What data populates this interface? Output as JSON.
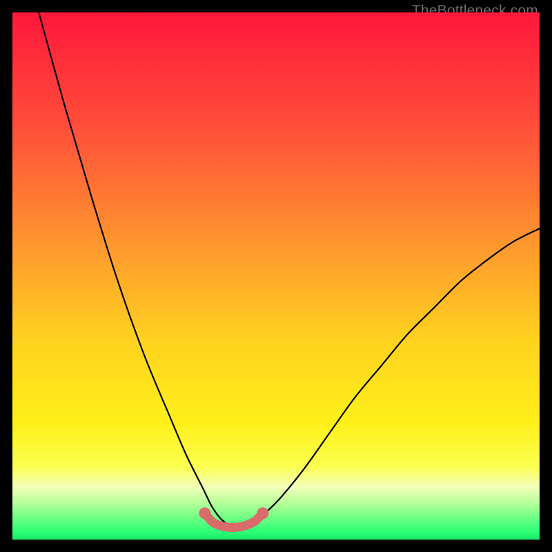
{
  "watermark": "TheBottleneck.com",
  "colors": {
    "gradient_stops": [
      {
        "offset": 0.0,
        "color": "#ff173b"
      },
      {
        "offset": 0.22,
        "color": "#ff4f3a"
      },
      {
        "offset": 0.45,
        "color": "#ff9a2e"
      },
      {
        "offset": 0.62,
        "color": "#ffd21f"
      },
      {
        "offset": 0.78,
        "color": "#fff01a"
      },
      {
        "offset": 0.86,
        "color": "#fbff4e"
      },
      {
        "offset": 0.9,
        "color": "#f3ffb9"
      },
      {
        "offset": 0.93,
        "color": "#b8ff9a"
      },
      {
        "offset": 0.96,
        "color": "#6bff82"
      },
      {
        "offset": 0.985,
        "color": "#2eff77"
      },
      {
        "offset": 1.0,
        "color": "#17e86a"
      }
    ],
    "curve": "#000000",
    "marker_fill": "#d96b6b",
    "marker_stroke": "#b85151"
  },
  "chart_data": {
    "type": "line",
    "title": "",
    "xlabel": "",
    "ylabel": "",
    "xlim": [
      0,
      100
    ],
    "ylim": [
      0,
      100
    ],
    "series": [
      {
        "name": "bottleneck-curve",
        "x": [
          5,
          10,
          15,
          20,
          25,
          30,
          33,
          36,
          38,
          40,
          42,
          44,
          46,
          50,
          55,
          60,
          65,
          70,
          75,
          80,
          85,
          90,
          95,
          100
        ],
        "y": [
          100,
          82,
          65,
          49,
          35,
          23,
          16,
          10,
          6,
          3.5,
          2.5,
          2.5,
          3.5,
          7,
          13,
          20,
          27,
          33,
          39,
          44,
          49,
          53,
          56.5,
          59
        ]
      }
    ],
    "bottom_markers": {
      "name": "optimal-range",
      "x": [
        36.5,
        38,
        40,
        42,
        44,
        46,
        47.5
      ],
      "y": [
        5.0,
        3.3,
        2.5,
        2.3,
        2.6,
        3.5,
        5.0
      ]
    }
  }
}
